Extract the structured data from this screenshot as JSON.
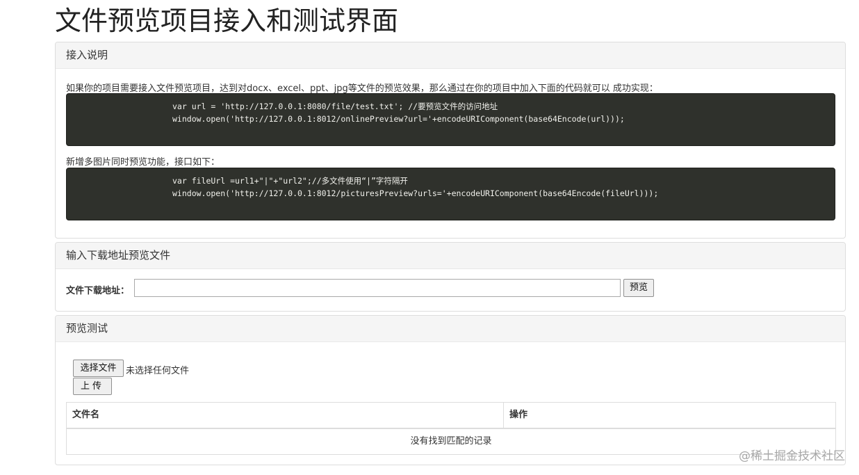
{
  "page": {
    "title": "文件预览项目接入和测试界面"
  },
  "intro": {
    "heading": "接入说明",
    "desc1": "如果你的项目需要接入文件预览项目，达到对docx、excel、ppt、jpg等文件的预览效果，那么通过在你的项目中加入下面的代码就可以 成功实现：",
    "code1": [
      "var url = 'http://127.0.0.1:8080/file/test.txt'; //要预览文件的访问地址",
      "window.open('http://127.0.0.1:8012/onlinePreview?url='+encodeURIComponent(base64Encode(url)));"
    ],
    "desc2": "新增多图片同时预览功能，接口如下：",
    "code2": [
      "var fileUrl =url1+\"|\"+\"url2\";//多文件使用“|”字符隔开",
      "window.open('http://127.0.0.1:8012/picturesPreview?urls='+encodeURIComponent(base64Encode(fileUrl)));"
    ]
  },
  "download": {
    "heading": "输入下载地址预览文件",
    "label": "文件下载地址：",
    "input_value": "",
    "preview_button": "预览"
  },
  "test": {
    "heading": "预览测试",
    "choose_button": "选择文件",
    "file_status": "未选择任何文件",
    "upload_button": "上传",
    "table": {
      "columns": [
        "文件名",
        "操作"
      ],
      "empty_text": "没有找到匹配的记录"
    }
  },
  "watermark": "@稀土掘金技术社区"
}
